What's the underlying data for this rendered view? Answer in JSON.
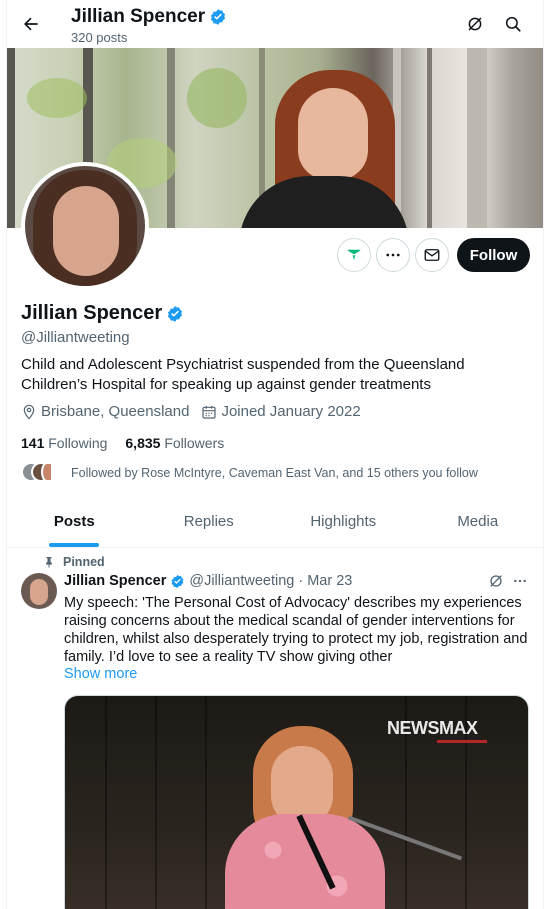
{
  "header": {
    "name": "Jillian Spencer",
    "posts_count": "320 posts"
  },
  "profile": {
    "name": "Jillian Spencer",
    "handle": "@Jilliantweeting",
    "bio": "Child and Adolescent Psychiatrist suspended from the Queensland Children’s Hospital for speaking up against gender treatments",
    "location": "Brisbane, Queensland",
    "joined": "Joined January 2022",
    "following_count": "141",
    "following_label": "Following",
    "followers_count": "6,835",
    "followers_label": "Followers",
    "followed_by": "Followed by Rose McIntyre, Caveman East Van, and 15 others you follow",
    "follow_label": "Follow"
  },
  "tabs": [
    {
      "label": "Posts",
      "active": true
    },
    {
      "label": "Replies",
      "active": false
    },
    {
      "label": "Highlights",
      "active": false
    },
    {
      "label": "Media",
      "active": false
    }
  ],
  "pinned_post": {
    "pinned_label": "Pinned",
    "author": "Jillian Spencer",
    "handle": "@Jilliantweeting",
    "separator": "·",
    "date": "Mar 23",
    "text": "My speech: 'The Personal Cost of Advocacy' describes my experiences raising concerns about the medical scandal of gender interventions for children, whilst also desperately trying to protect my job, registration and family. I’d love to see a reality TV show giving other",
    "show_more": "Show more",
    "media_logo": "NEWSMAX"
  },
  "colors": {
    "accent": "#1d9bf0",
    "verified": "#1d9bf0",
    "text_primary": "#0f1419",
    "text_secondary": "#536471",
    "follow_button_bg": "#0f1419"
  },
  "icons": {
    "back": "arrow-left-icon",
    "grok": "grok-icon",
    "search": "search-icon",
    "verified": "verified-badge-icon",
    "subscribe": "subscribe-icon",
    "more": "more-icon",
    "message": "message-icon",
    "location": "location-icon",
    "calendar": "calendar-icon",
    "pin": "pin-icon"
  }
}
